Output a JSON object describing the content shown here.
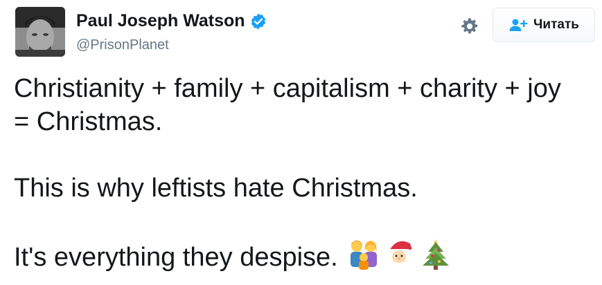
{
  "profile": {
    "display_name": "Paul Joseph Watson",
    "handle": "@PrisonPlanet",
    "verified": true
  },
  "actions": {
    "follow_label": "Читать",
    "settings_icon": "gear-icon",
    "follow_icon": "add-user-icon"
  },
  "tweet": {
    "line1": "Christianity + family + capitalism + charity + joy",
    "line2": "= Christmas.",
    "line3": "This is why leftists hate Christmas.",
    "line4": "It's everything they despise.",
    "emojis": [
      "family-emoji",
      "santa-emoji",
      "christmas-tree-emoji"
    ]
  },
  "colors": {
    "verified_blue": "#1da1f2",
    "handle_gray": "#657786",
    "follow_icon_blue": "#1da1f2"
  }
}
